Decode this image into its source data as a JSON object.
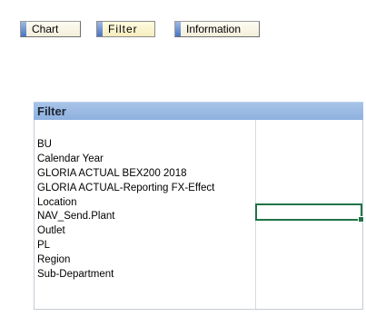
{
  "tabs": [
    {
      "label": "Chart",
      "active": false
    },
    {
      "label": "Filter",
      "active": true
    },
    {
      "label": "Information",
      "active": false
    }
  ],
  "panel": {
    "title": "Filter",
    "items": [
      "BU",
      "Calendar Year",
      "GLORIA ACTUAL BEX200 2018",
      "GLORIA ACTUAL-Reporting FX-Effect",
      "Location",
      "NAV_Send.Plant",
      "Outlet",
      "PL",
      "Region",
      "Sub-Department"
    ]
  },
  "colors": {
    "tab_accent": "#4a74c3",
    "header_bg": "#8eb1de",
    "selection_border": "#217346"
  }
}
